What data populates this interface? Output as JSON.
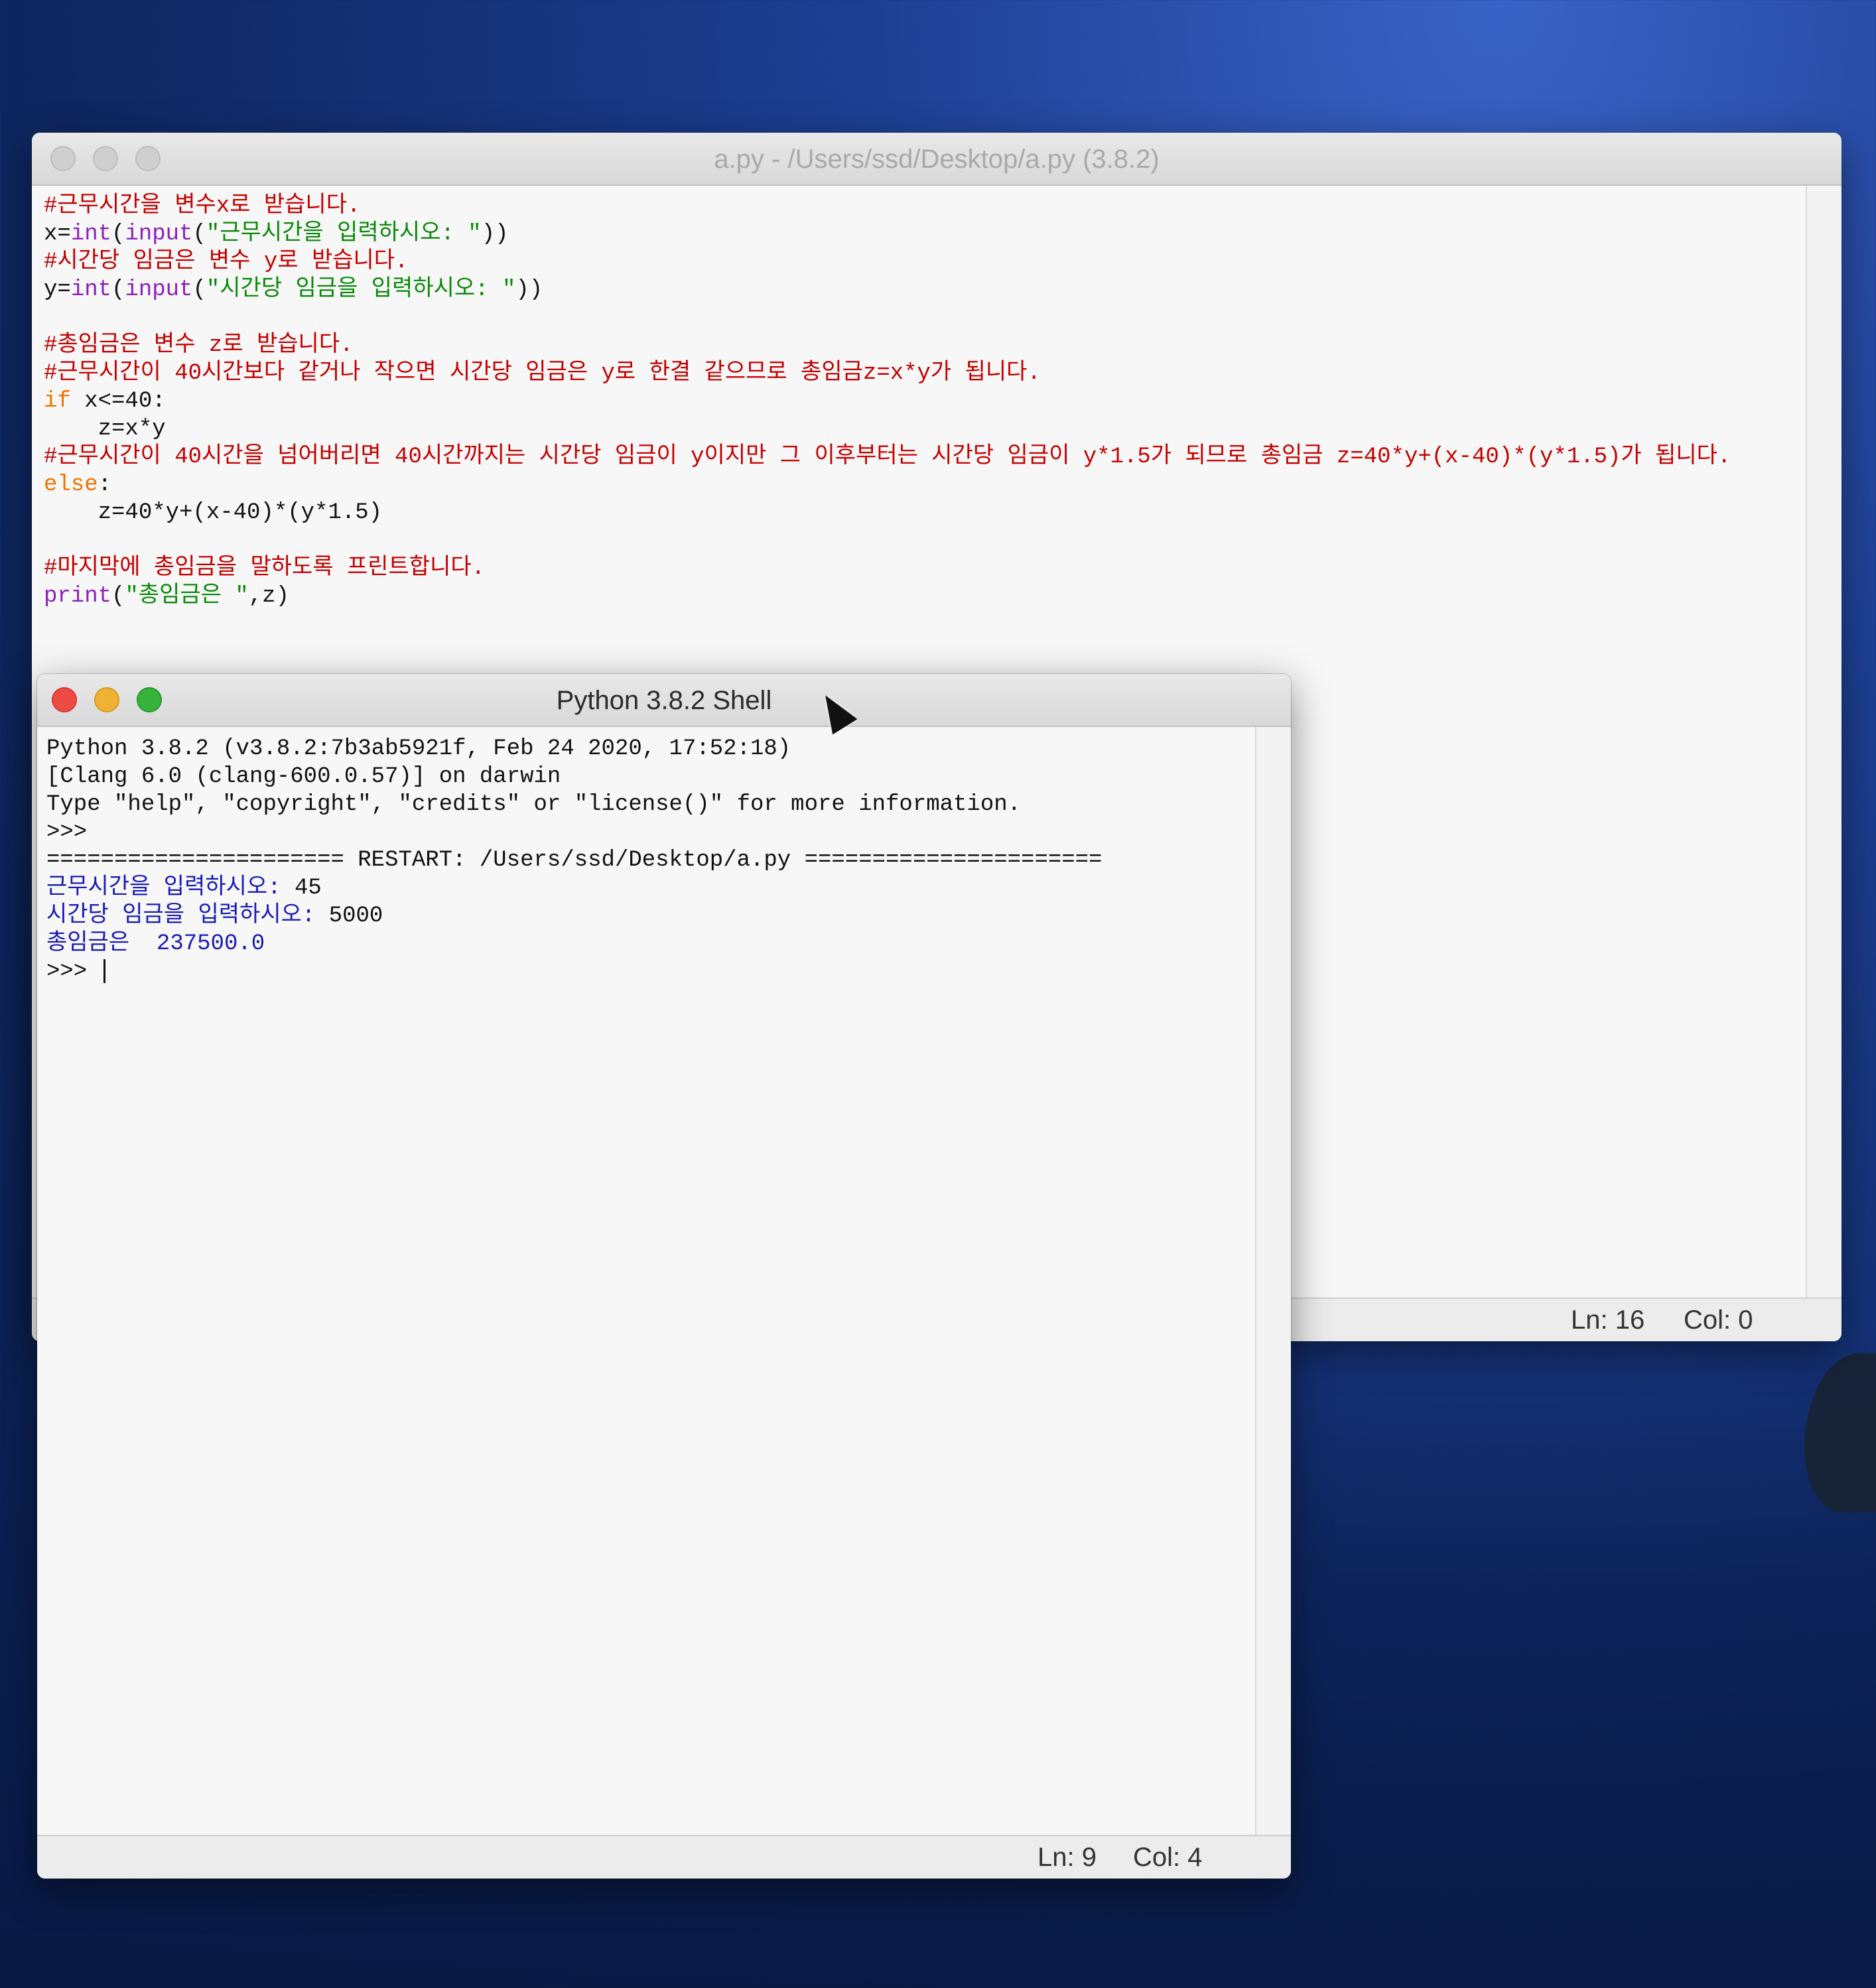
{
  "editor": {
    "title": "a.py - /Users/ssd/Desktop/a.py (3.8.2)",
    "status": {
      "ln": "Ln: 16",
      "col": "Col: 0"
    },
    "lines": [
      [
        {
          "t": "#근무시간을 변수x로 받습니다.",
          "c": "comment"
        }
      ],
      [
        {
          "t": "x=",
          "c": "code"
        },
        {
          "t": "int",
          "c": "builtin"
        },
        {
          "t": "(",
          "c": "code"
        },
        {
          "t": "input",
          "c": "builtin"
        },
        {
          "t": "(",
          "c": "code"
        },
        {
          "t": "\"근무시간을 입력하시오: \"",
          "c": "string"
        },
        {
          "t": "))",
          "c": "code"
        }
      ],
      [
        {
          "t": "#시간당 임금은 변수 y로 받습니다.",
          "c": "comment"
        }
      ],
      [
        {
          "t": "y=",
          "c": "code"
        },
        {
          "t": "int",
          "c": "builtin"
        },
        {
          "t": "(",
          "c": "code"
        },
        {
          "t": "input",
          "c": "builtin"
        },
        {
          "t": "(",
          "c": "code"
        },
        {
          "t": "\"시간당 임금을 입력하시오: \"",
          "c": "string"
        },
        {
          "t": "))",
          "c": "code"
        }
      ],
      [
        {
          "t": "",
          "c": "code"
        }
      ],
      [
        {
          "t": "#총임금은 변수 z로 받습니다.",
          "c": "comment"
        }
      ],
      [
        {
          "t": "#근무시간이 40시간보다 같거나 작으면 시간당 임금은 y로 한결 같으므로 총임금z=x*y가 됩니다.",
          "c": "comment"
        }
      ],
      [
        {
          "t": "if",
          "c": "keyword"
        },
        {
          "t": " x<=40:",
          "c": "code"
        }
      ],
      [
        {
          "t": "    z=x*y",
          "c": "code"
        }
      ],
      [
        {
          "t": "#근무시간이 40시간을 넘어버리면 40시간까지는 시간당 임금이 y이지만 그 이후부터는 시간당 임금이 y*1.5가 되므로 총임금 z=40*y+(x-40)*(y*1.5)가 됩니다.",
          "c": "comment"
        }
      ],
      [
        {
          "t": "else",
          "c": "keyword"
        },
        {
          "t": ":",
          "c": "code"
        }
      ],
      [
        {
          "t": "    z=40*y+(x-40)*(y*1.5)",
          "c": "code"
        }
      ],
      [
        {
          "t": "",
          "c": "code"
        }
      ],
      [
        {
          "t": "#마지막에 총임금을 말하도록 프린트합니다.",
          "c": "comment"
        }
      ],
      [
        {
          "t": "print",
          "c": "builtin"
        },
        {
          "t": "(",
          "c": "code"
        },
        {
          "t": "\"총임금은 \"",
          "c": "string"
        },
        {
          "t": ",z)",
          "c": "code"
        }
      ]
    ]
  },
  "shell": {
    "title": "Python 3.8.2 Shell",
    "status": {
      "ln": "Ln: 9",
      "col": "Col: 4"
    },
    "lines": [
      [
        {
          "t": "Python 3.8.2 (v3.8.2:7b3ab5921f, Feb 24 2020, 17:52:18)",
          "c": "std"
        }
      ],
      [
        {
          "t": "[Clang 6.0 (clang-600.0.57)] on darwin",
          "c": "std"
        }
      ],
      [
        {
          "t": "Type \"help\", \"copyright\", \"credits\" or \"license()\" for more information.",
          "c": "std"
        }
      ],
      [
        {
          "t": ">>> ",
          "c": "std"
        }
      ],
      [
        {
          "t": "====================== RESTART: /Users/ssd/Desktop/a.py ======================",
          "c": "std"
        }
      ],
      [
        {
          "t": "근무시간을 입력하시오: ",
          "c": "out"
        },
        {
          "t": "45",
          "c": "std"
        }
      ],
      [
        {
          "t": "시간당 임금을 입력하시오: ",
          "c": "out"
        },
        {
          "t": "5000",
          "c": "std"
        }
      ],
      [
        {
          "t": "총임금은  237500.0",
          "c": "out"
        }
      ],
      [
        {
          "t": ">>> ",
          "c": "std"
        }
      ]
    ]
  }
}
